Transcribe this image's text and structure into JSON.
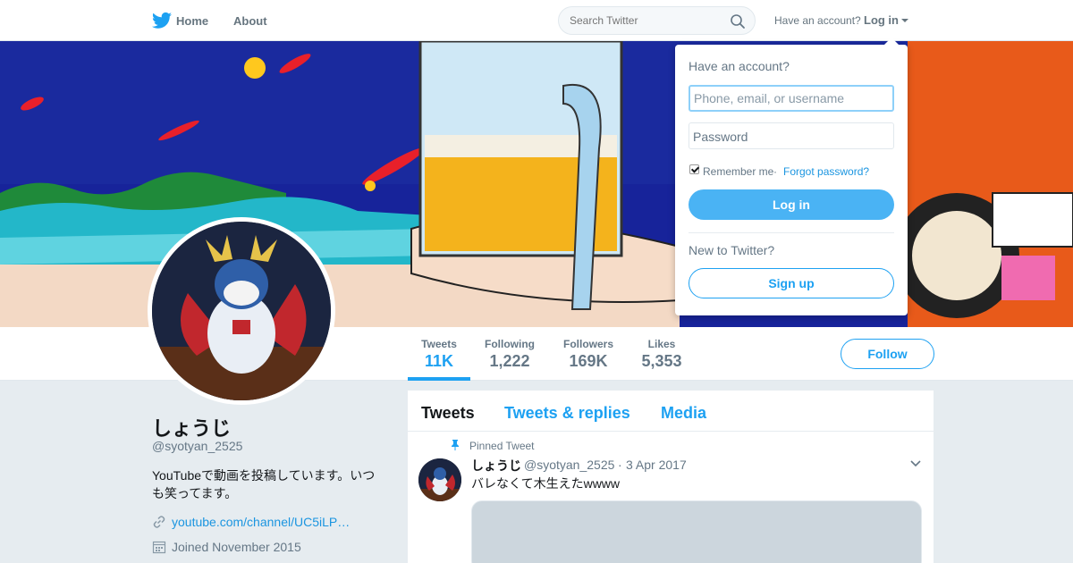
{
  "nav": {
    "home_label": "Home",
    "about_label": "About",
    "search_placeholder": "Search Twitter",
    "have_account": "Have an account?",
    "login_label": "Log in",
    "brand_color": "#1da1f2"
  },
  "profile": {
    "name": "しょうじ",
    "handle": "@syotyan_2525",
    "bio": "YouTubeで動画を投稿しています。いつも笑ってます。",
    "link": "youtube.com/channel/UC5iLP…",
    "joined": "Joined November 2015"
  },
  "stats": [
    {
      "label": "Tweets",
      "value": "11K",
      "active": true
    },
    {
      "label": "Following",
      "value": "1,222",
      "active": false
    },
    {
      "label": "Followers",
      "value": "169K",
      "active": false
    },
    {
      "label": "Likes",
      "value": "5,353",
      "active": false
    }
  ],
  "follow_label": "Follow",
  "tabs": [
    {
      "label": "Tweets",
      "active": true
    },
    {
      "label": "Tweets & replies",
      "active": false
    },
    {
      "label": "Media",
      "active": false
    }
  ],
  "tweet": {
    "pinned_label": "Pinned Tweet",
    "name": "しょうじ",
    "handle": "@syotyan_2525",
    "separator": "·",
    "date": "3 Apr 2017",
    "text": "バレなくて木生えたwwww"
  },
  "login_dropdown": {
    "title": "Have an account?",
    "username_placeholder": "Phone, email, or username",
    "password_placeholder": "Password",
    "remember_label": "Remember me",
    "separator": "·",
    "forgot_label": "Forgot password?",
    "login_button": "Log in",
    "new_label": "New to Twitter?",
    "signup_button": "Sign up"
  }
}
